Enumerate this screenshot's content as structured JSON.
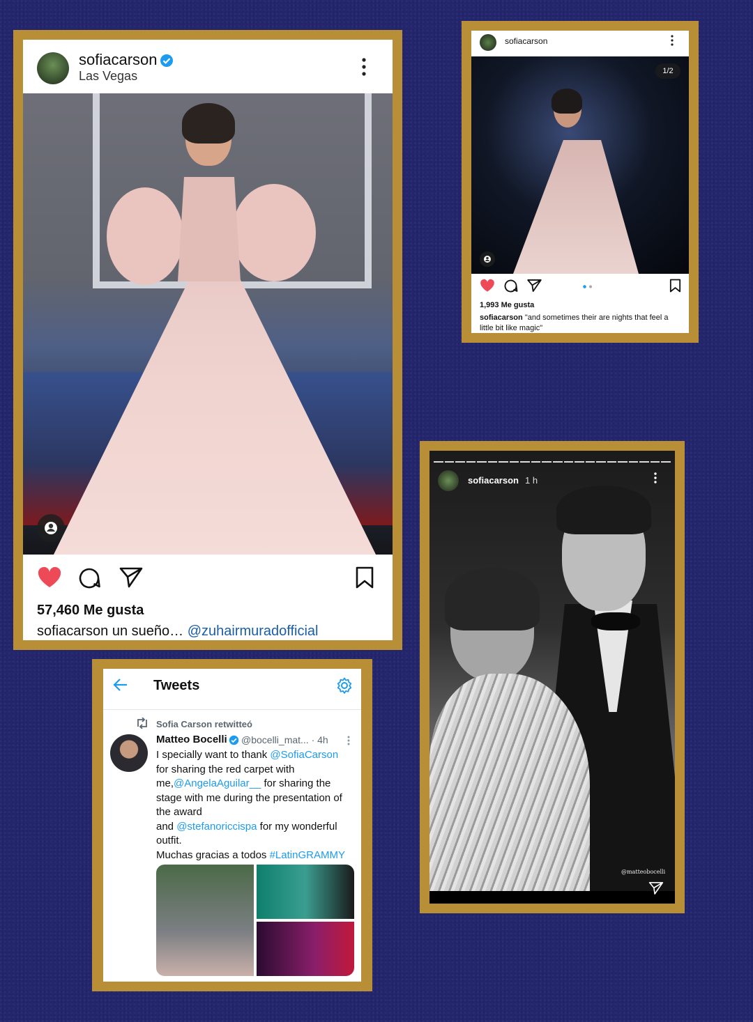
{
  "colors": {
    "background": "#24266e",
    "frame": "#b88f36",
    "heart": "#ed4956",
    "link_instagram": "#1a5dab",
    "link_twitter": "#1d9bf0",
    "verified": "#1d9bf0"
  },
  "post_main": {
    "username": "sofiacarson",
    "location": "Las Vegas",
    "likes": "57,460 Me gusta",
    "caption_user": "sofiacarson",
    "caption_text": "un sueño…",
    "caption_mention": "@zuhairmuradofficial",
    "icons": [
      "verified-icon",
      "more-icon",
      "tag-user-icon",
      "heart-icon",
      "comment-icon",
      "share-icon",
      "bookmark-icon"
    ]
  },
  "post_small": {
    "username": "sofiacarson",
    "counter": "1/2",
    "likes": "1,993 Me gusta",
    "caption_user": "sofiacarson",
    "caption_text": "\"and sometimes their are nights that feel a little bit like magic\""
  },
  "tweets": {
    "header_title": "Tweets",
    "retweet_label": "Sofia Carson retwitteó",
    "name": "Matteo Bocelli",
    "handle": "@bocelli_mat...",
    "time": "· 4h",
    "lines": [
      {
        "pre": "I specially want to thank ",
        "link": "@SofiaCarson",
        "post": ""
      },
      {
        "pre": "for sharing the red carpet with",
        "link": "",
        "post": ""
      },
      {
        "pre": "me,",
        "link": "@AngelaAguilar__",
        "post": " for sharing the"
      },
      {
        "pre": "stage with me during the presentation of",
        "link": "",
        "post": ""
      },
      {
        "pre": "the award",
        "link": "",
        "post": ""
      },
      {
        "pre": "and ",
        "link": "@stefanoriccispa",
        "post": " for my wonderful"
      },
      {
        "pre": "outfit.",
        "link": "",
        "post": ""
      },
      {
        "pre": "Muchas gracias a todos ",
        "link": "#LatinGRAMMY",
        "post": ""
      }
    ]
  },
  "story": {
    "username": "sofiacarson",
    "time": "1 h",
    "watermark": "@matteobocelli"
  }
}
